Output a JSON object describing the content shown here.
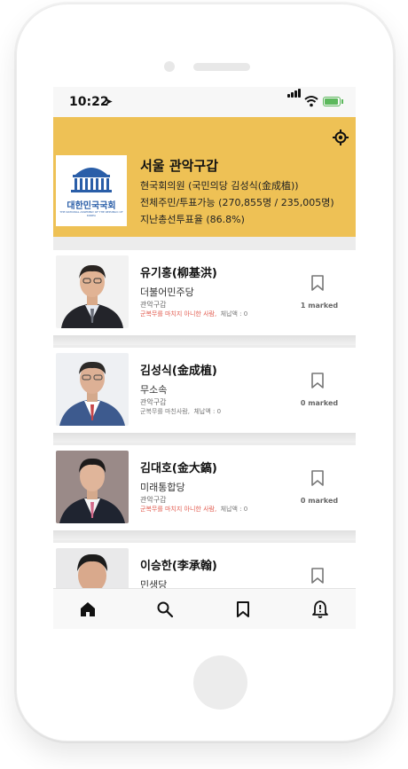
{
  "status_bar": {
    "time": "10:22"
  },
  "header": {
    "logo_text": "대한민국국회",
    "logo_subtext": "THE NATIONAL ASSEMBLY OF THE REPUBLIC OF KOREA",
    "district": "서울 관악구갑",
    "incumbent": "현국회의원 (국민의당 김성식(金成植))",
    "voters": "전체주민/투표가능 (270,855명 / 235,005명)",
    "turnout": "지난총선투표율 (86.8%)",
    "accent_color": "#eec155"
  },
  "candidates": [
    {
      "name": "유기홍(柳基洪)",
      "party": "더불어민주당",
      "district": "관악구갑",
      "military": "군복무를 마치지 아니한 사람,",
      "tax": "체납액 : 0",
      "marked": "1 marked"
    },
    {
      "name": "김성식(金成植)",
      "party": "무소속",
      "district": "관악구갑",
      "military": "군복무를 마친사람,",
      "tax": "체납액 : 0",
      "marked": "0 marked"
    },
    {
      "name": "김대호(金大鎬)",
      "party": "미래통합당",
      "district": "관악구갑",
      "military": "군복무를 마치지 아니한 사람,",
      "tax": "체납액 : 0",
      "marked": "0 marked"
    },
    {
      "name": "이승한(李承翰)",
      "party": "민생당"
    }
  ],
  "tabbar": {
    "icons": [
      "home-icon",
      "search-icon",
      "bookmark-icon",
      "notification-bell-icon"
    ]
  }
}
